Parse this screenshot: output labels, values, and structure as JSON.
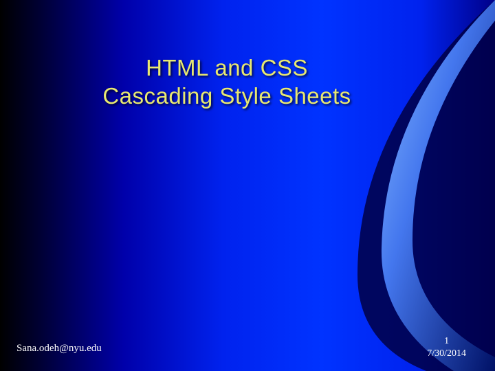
{
  "title": {
    "line1": "HTML and CSS",
    "line2": "Cascading Style Sheets"
  },
  "footer": {
    "author": "Sana.odeh@nyu.edu",
    "page_number": "1",
    "date": "7/30/2014"
  },
  "colors": {
    "title_color": "#e8e870",
    "bg_dark": "#000022",
    "bg_blue": "#0033ff"
  }
}
